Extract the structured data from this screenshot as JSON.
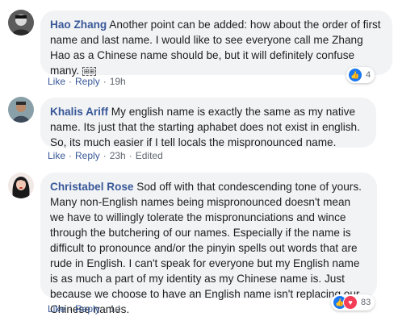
{
  "comments": [
    {
      "author": "Hao Zhang",
      "text": "Another point can be added: how about the order of first name and last name. I would like to see everyone call me Zhang Hao as a Chinese name should be, but it will definitely confuse many.",
      "emoji_glyph": "⊞⊞",
      "actions": {
        "like": "Like",
        "reply": "Reply",
        "time": "19h"
      },
      "reactions": {
        "count": "4"
      }
    },
    {
      "author": "Khalis Ariff",
      "text": "My english name is exactly the same as my native name. Its just that the starting aphabet does not exist in english. So, its much easier if I tell locals the mispronounced name.",
      "actions": {
        "like": "Like",
        "reply": "Reply",
        "time": "23h",
        "edited": "Edited"
      }
    },
    {
      "author": "Christabel Rose",
      "text": "Sod off with that condescending tone of yours. Many non-English names being mispronounced doesn't mean we have to willingly tolerate the mispronunciations and wince through the butchering of our names. Especially if the name is difficult to pronounce and/or the pinyin spells out words that are rude in English. I can't speak for everyone but my English name is as much a part of my identity as my Chinese name is. Just because we choose to have an English name isn't replacing our Chinese names.",
      "actions": {
        "like": "Like",
        "reply": "Reply",
        "time": "1d"
      },
      "reactions": {
        "count": "83"
      }
    }
  ]
}
